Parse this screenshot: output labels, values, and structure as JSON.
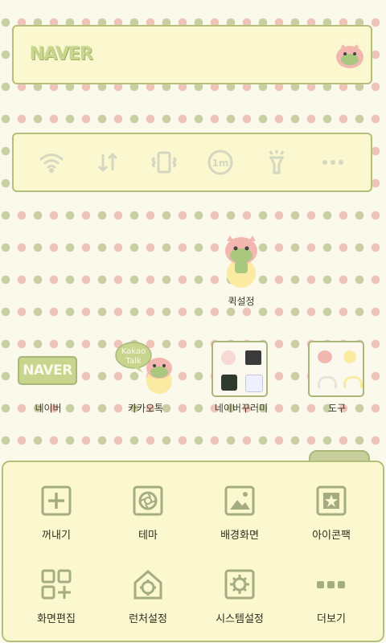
{
  "search": {
    "brand": "NAVER"
  },
  "toggles": [
    {
      "icon": "wifi-icon"
    },
    {
      "icon": "data-sync-icon"
    },
    {
      "icon": "vibrate-icon"
    },
    {
      "icon": "screen-timeout-icon",
      "text": "1m"
    },
    {
      "icon": "flashlight-icon"
    },
    {
      "icon": "more-icon"
    }
  ],
  "widget": {
    "label": "퀵설정"
  },
  "apps": [
    {
      "label": "네이버",
      "logo_text": "NAVER"
    },
    {
      "label": "카카오톡",
      "bubble_line1": "Kakao",
      "bubble_line2": "Talk"
    },
    {
      "label": "네이버꾸러미"
    },
    {
      "label": "도구"
    }
  ],
  "menu": [
    {
      "label": "꺼내기",
      "icon": "add-box-icon"
    },
    {
      "label": "테마",
      "icon": "theme-icon"
    },
    {
      "label": "배경화면",
      "icon": "wallpaper-icon"
    },
    {
      "label": "아이콘팩",
      "icon": "icon-pack-icon"
    },
    {
      "label": "화면편집",
      "icon": "screen-edit-icon"
    },
    {
      "label": "런처설정",
      "icon": "launcher-settings-icon"
    },
    {
      "label": "시스템설정",
      "icon": "system-settings-icon"
    },
    {
      "label": "더보기",
      "icon": "more-dots-icon"
    }
  ],
  "colors": {
    "accent": "#a9b77a",
    "panel": "#fbf7cf",
    "dot_green": "#c8cfa3",
    "dot_pink": "#f0c3b9"
  }
}
